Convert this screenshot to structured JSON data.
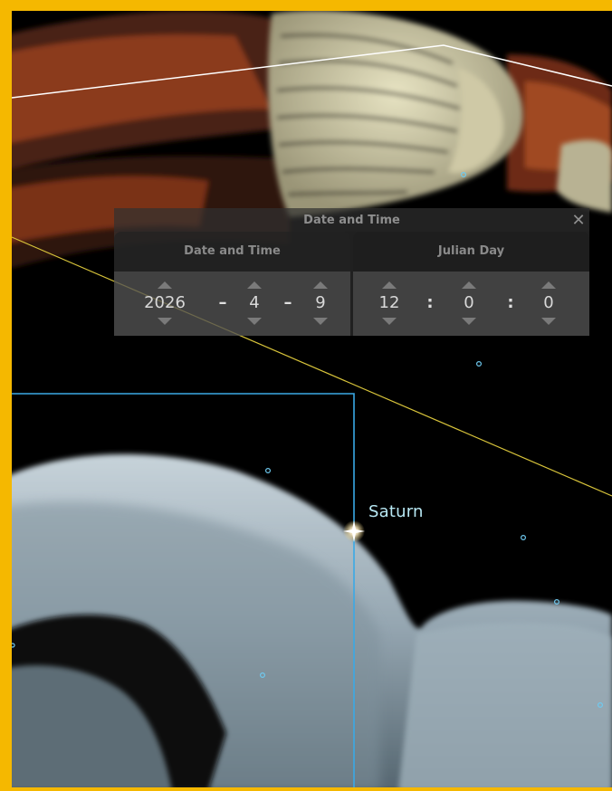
{
  "labels": {
    "planet": "Saturn"
  },
  "dialog": {
    "title": "Date and Time",
    "close_glyph": "✕",
    "tabs": [
      "Date and Time",
      "Julian Day"
    ],
    "date": {
      "year": "2026",
      "month": "4",
      "day": "9",
      "separator": "–"
    },
    "time": {
      "hour": "12",
      "minute": "0",
      "second": "0",
      "separator": ":"
    }
  },
  "colors": {
    "frame": "#f5b800",
    "constellation_boundary": "#3aa9e6",
    "ecliptic": "#d7c33a",
    "planet_label": "#b8e8f4"
  },
  "icons": {
    "close": "close-icon",
    "increment": "arrow-up-icon",
    "decrement": "arrow-down-icon"
  }
}
